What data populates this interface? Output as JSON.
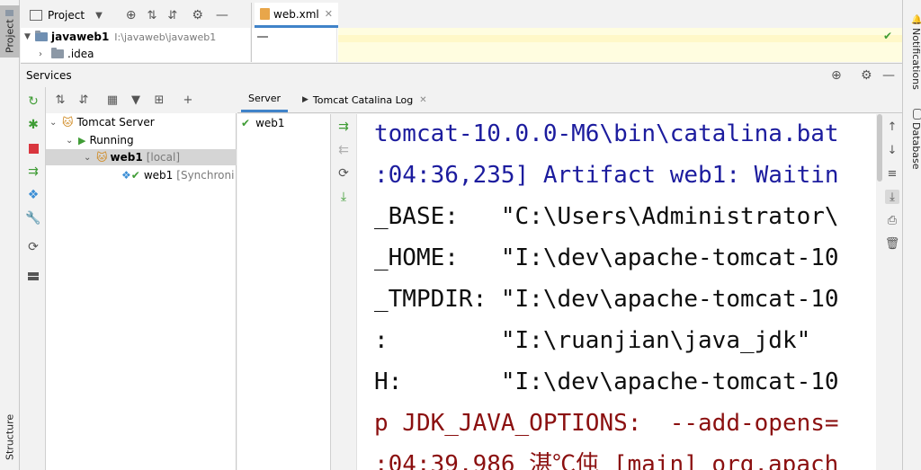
{
  "colors": {
    "accent": "#4083c9",
    "console_blue": "#1c1c9e",
    "console_black": "#0e0e0e",
    "console_red": "#8b1010",
    "run_green": "#3f9c35",
    "stop_red": "#d9363e",
    "selection": "#d5d5d5"
  },
  "side_tabs": {
    "project": "Project",
    "structure": "Structure",
    "notifications": "Notifications",
    "database": "Database"
  },
  "project_panel": {
    "title": "Project",
    "root_name": "javaweb1",
    "root_path": "I:\\javaweb\\javaweb1",
    "child": ".idea"
  },
  "editor": {
    "tab_label": "web.xml",
    "file_icon": "xml-file-icon"
  },
  "services": {
    "title": "Services",
    "tree": {
      "server": "Tomcat Server",
      "state": "Running",
      "config": "web1",
      "config_suffix": "[local]",
      "artifact": "web1",
      "artifact_status": "[Synchroni"
    },
    "tabs": {
      "server": "Server",
      "log": "Tomcat Catalina Log"
    },
    "deployments": [
      "web1"
    ],
    "console_lines": [
      {
        "text": "tomcat-10.0.0-M6\\bin\\catalina.bat",
        "color": "blue"
      },
      {
        "text": ":04:36,235] Artifact web1: Waitin",
        "color": "blue"
      },
      {
        "text": "_BASE:   \"C:\\Users\\Administrator\\",
        "color": "black"
      },
      {
        "text": "_HOME:   \"I:\\dev\\apache-tomcat-10",
        "color": "black"
      },
      {
        "text": "_TMPDIR: \"I:\\dev\\apache-tomcat-10",
        "color": "black"
      },
      {
        "text": ":        \"I:\\ruanjian\\java_jdk\"",
        "color": "black"
      },
      {
        "text": "H:       \"I:\\dev\\apache-tomcat-10",
        "color": "black"
      },
      {
        "text": "p JDK_JAVA_OPTIONS:  --add-opens=",
        "color": "red"
      },
      {
        "text": ":04:39.986 湛℃伅 [main] org.apach",
        "color": "red"
      }
    ]
  }
}
